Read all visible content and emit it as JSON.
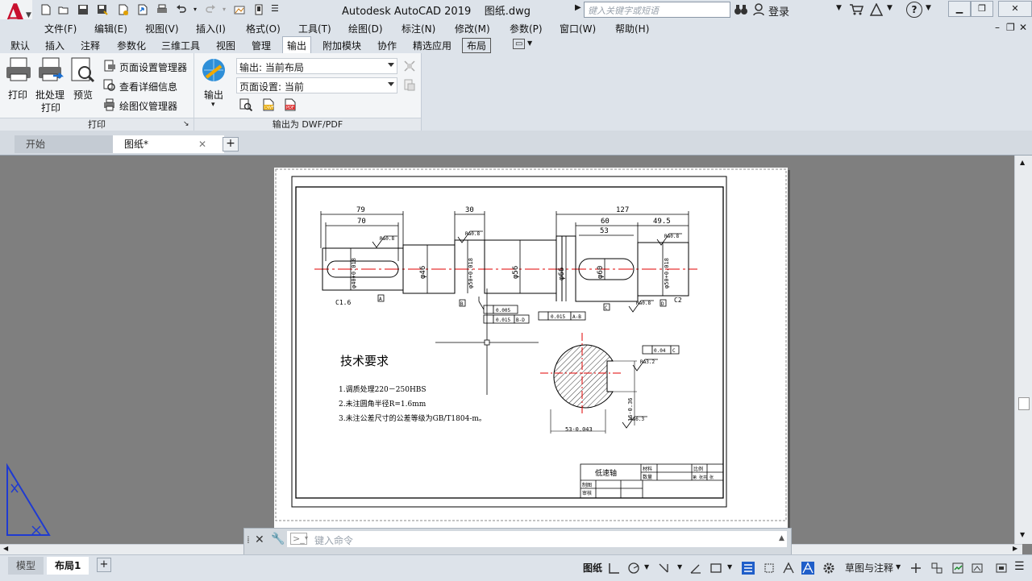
{
  "titlebar": {
    "title": "Autodesk AutoCAD 2019",
    "filename": "图纸.dwg",
    "search_placeholder": "键入关键字或短语",
    "signin_label": "登录"
  },
  "menubar": {
    "items": [
      "文件(F)",
      "编辑(E)",
      "视图(V)",
      "插入(I)",
      "格式(O)",
      "工具(T)",
      "绘图(D)",
      "标注(N)",
      "修改(M)",
      "参数(P)",
      "窗口(W)",
      "帮助(H)"
    ]
  },
  "ribbon_tabs": {
    "items": [
      "默认",
      "插入",
      "注释",
      "参数化",
      "三维工具",
      "视图",
      "管理",
      "输出",
      "附加模块",
      "协作",
      "精选应用",
      "布局"
    ],
    "active": "输出"
  },
  "ribbon": {
    "plot_label": "打印",
    "batch_plot_label_1": "批处理",
    "batch_plot_label_2": "打印",
    "preview_label": "预览",
    "page_setup_manager": "页面设置管理器",
    "view_details": "查看详细信息",
    "plotter_manager": "绘图仪管理器",
    "plot_panel_title": "打印",
    "export_label": "输出",
    "export_combo": "输出: 当前布局",
    "page_setup_combo": "页面设置: 当前",
    "export_panel_title": "输出为 DWF/PDF",
    "dwf_icon_text": "DWF",
    "pdf_icon_text": "PDF"
  },
  "doc_tabs": {
    "start": "开始",
    "current": "图纸*"
  },
  "drawing": {
    "dims": {
      "d79": "79",
      "d70": "70",
      "d30": "30",
      "d127": "127",
      "d60": "60",
      "d49_5": "49.5",
      "d53": "53",
      "phi46": "φ46",
      "phi56": "φ56",
      "phi66": "φ66",
      "phi60": "φ60",
      "phi40": "φ40+0.018",
      "phi50l": "φ50+0.018",
      "phi50r": "φ50+0.018",
      "ra08": "Ra0.8",
      "ra32": "Ra3.2",
      "ra63": "Ra6.3",
      "c16": "C1.6",
      "c2": "C2",
      "datumA": "A",
      "datumB": "B",
      "datumC": "C",
      "datumD": "D",
      "tol1": "0.005",
      "tol2": "0.015",
      "tol2ref": "B-D",
      "tol3": "0.015",
      "tol3ref": "A-B",
      "tol4": "0.04",
      "tol4ref": "C",
      "sec_h": "53-0.043",
      "sec_w": "16-0.36"
    },
    "tech_title": "技术要求",
    "tech_lines": [
      "1.调质处理220－250HBS",
      "2.未注圆角半径R=1.6mm",
      "3.未注公差尺寸的公差等级为GB/T1804-m。"
    ],
    "titleblock": {
      "name": "低速轴",
      "material": "材料",
      "qty": "数量",
      "scale": "比例",
      "sheet": "第 张共 张",
      "drawn": "制图",
      "checked": "审核"
    }
  },
  "cmdline": {
    "placeholder": "键入命令"
  },
  "layout_tabs": {
    "model": "模型",
    "layout1": "布局1"
  },
  "status": {
    "paper_label": "图纸",
    "workspace_label": "草图与注释"
  }
}
